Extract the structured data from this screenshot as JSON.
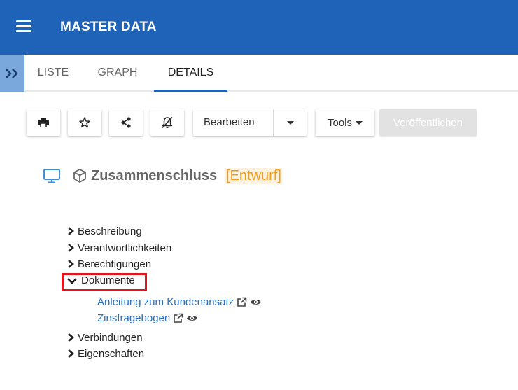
{
  "app": {
    "title": "MASTER DATA"
  },
  "tabs": [
    {
      "label": "LISTE"
    },
    {
      "label": "GRAPH"
    },
    {
      "label": "DETAILS",
      "active": true
    }
  ],
  "toolbar": {
    "print_icon": "printer-icon",
    "favorite_icon": "star-icon",
    "share_icon": "share-icon",
    "notification_icon": "bell-off-icon",
    "edit_label": "Bearbeiten",
    "tools_label": "Tools",
    "publish_label": "Veröffentlichen"
  },
  "object": {
    "type_icon": "monitor-icon",
    "kind_icon": "cube-icon",
    "title": "Zusammenschluss",
    "status": "[Entwurf]"
  },
  "tree": {
    "items": [
      {
        "label": "Beschreibung",
        "expanded": false
      },
      {
        "label": "Verantwortlichkeiten",
        "expanded": false
      },
      {
        "label": "Berechtigungen",
        "expanded": false
      },
      {
        "label": "Dokumente",
        "expanded": true
      },
      {
        "label": "Verbindungen",
        "expanded": false
      },
      {
        "label": "Eigenschaften",
        "expanded": false
      }
    ],
    "documents": [
      {
        "label": "Anleitung zum Kundenansatz"
      },
      {
        "label": "Zinsfragebogen"
      }
    ]
  },
  "colors": {
    "header": "#1e63b8",
    "side_toggle": "#7aa8dd",
    "status": "#f39c1b",
    "link": "#2a6fc0",
    "highlight": "#e0161b"
  }
}
